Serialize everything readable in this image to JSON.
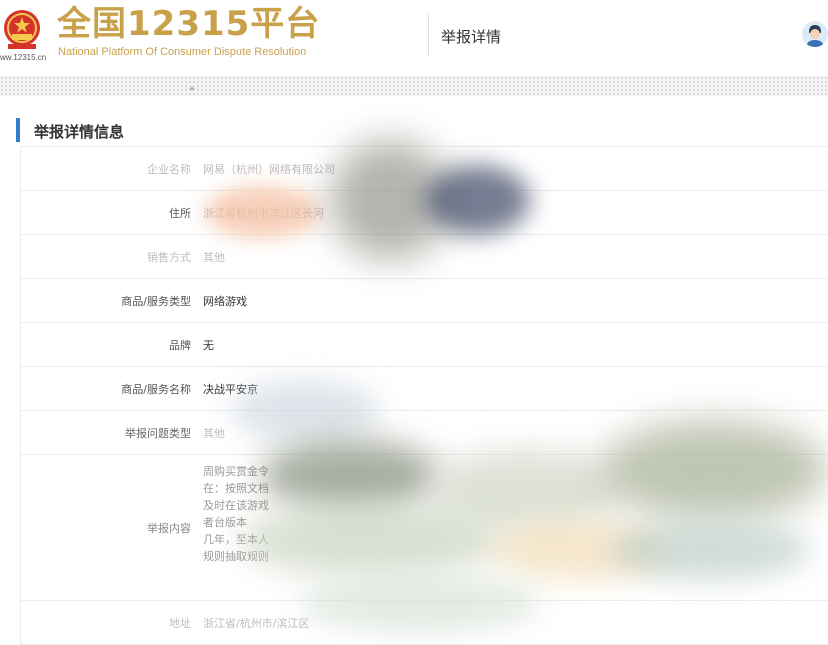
{
  "header": {
    "site_url": "ww.12315.cn",
    "brand_title": "全国12315平台",
    "brand_subtitle": "National Platform Of Consumer Dispute Resolution",
    "page_crumb": "举报详情",
    "brand_color": "#c9a14a"
  },
  "section": {
    "title": "举报详情信息",
    "accent_color": "#2f7fcf"
  },
  "rows": [
    {
      "label": "企业名称",
      "value": "网易（杭州）网络有限公司"
    },
    {
      "label": "住所",
      "value": "浙江省杭州市滨江区长河"
    },
    {
      "label": "销售方式",
      "value": "其他"
    },
    {
      "label": "商品/服务类型",
      "value": "网络游戏"
    },
    {
      "label": "品牌",
      "value": "无"
    },
    {
      "label": "商品/服务名称",
      "value": "决战平安京"
    },
    {
      "label": "举报问题类型",
      "value": "其他"
    },
    {
      "label": "举报内容",
      "lines": [
        "周购买赏金令",
        "在：按照文档",
        "及时在该游戏",
        "者台版本",
        "几年，至本人",
        "规则抽取规则"
      ]
    },
    {
      "label": "地址",
      "value": "浙江省/杭州市/滨江区"
    }
  ]
}
